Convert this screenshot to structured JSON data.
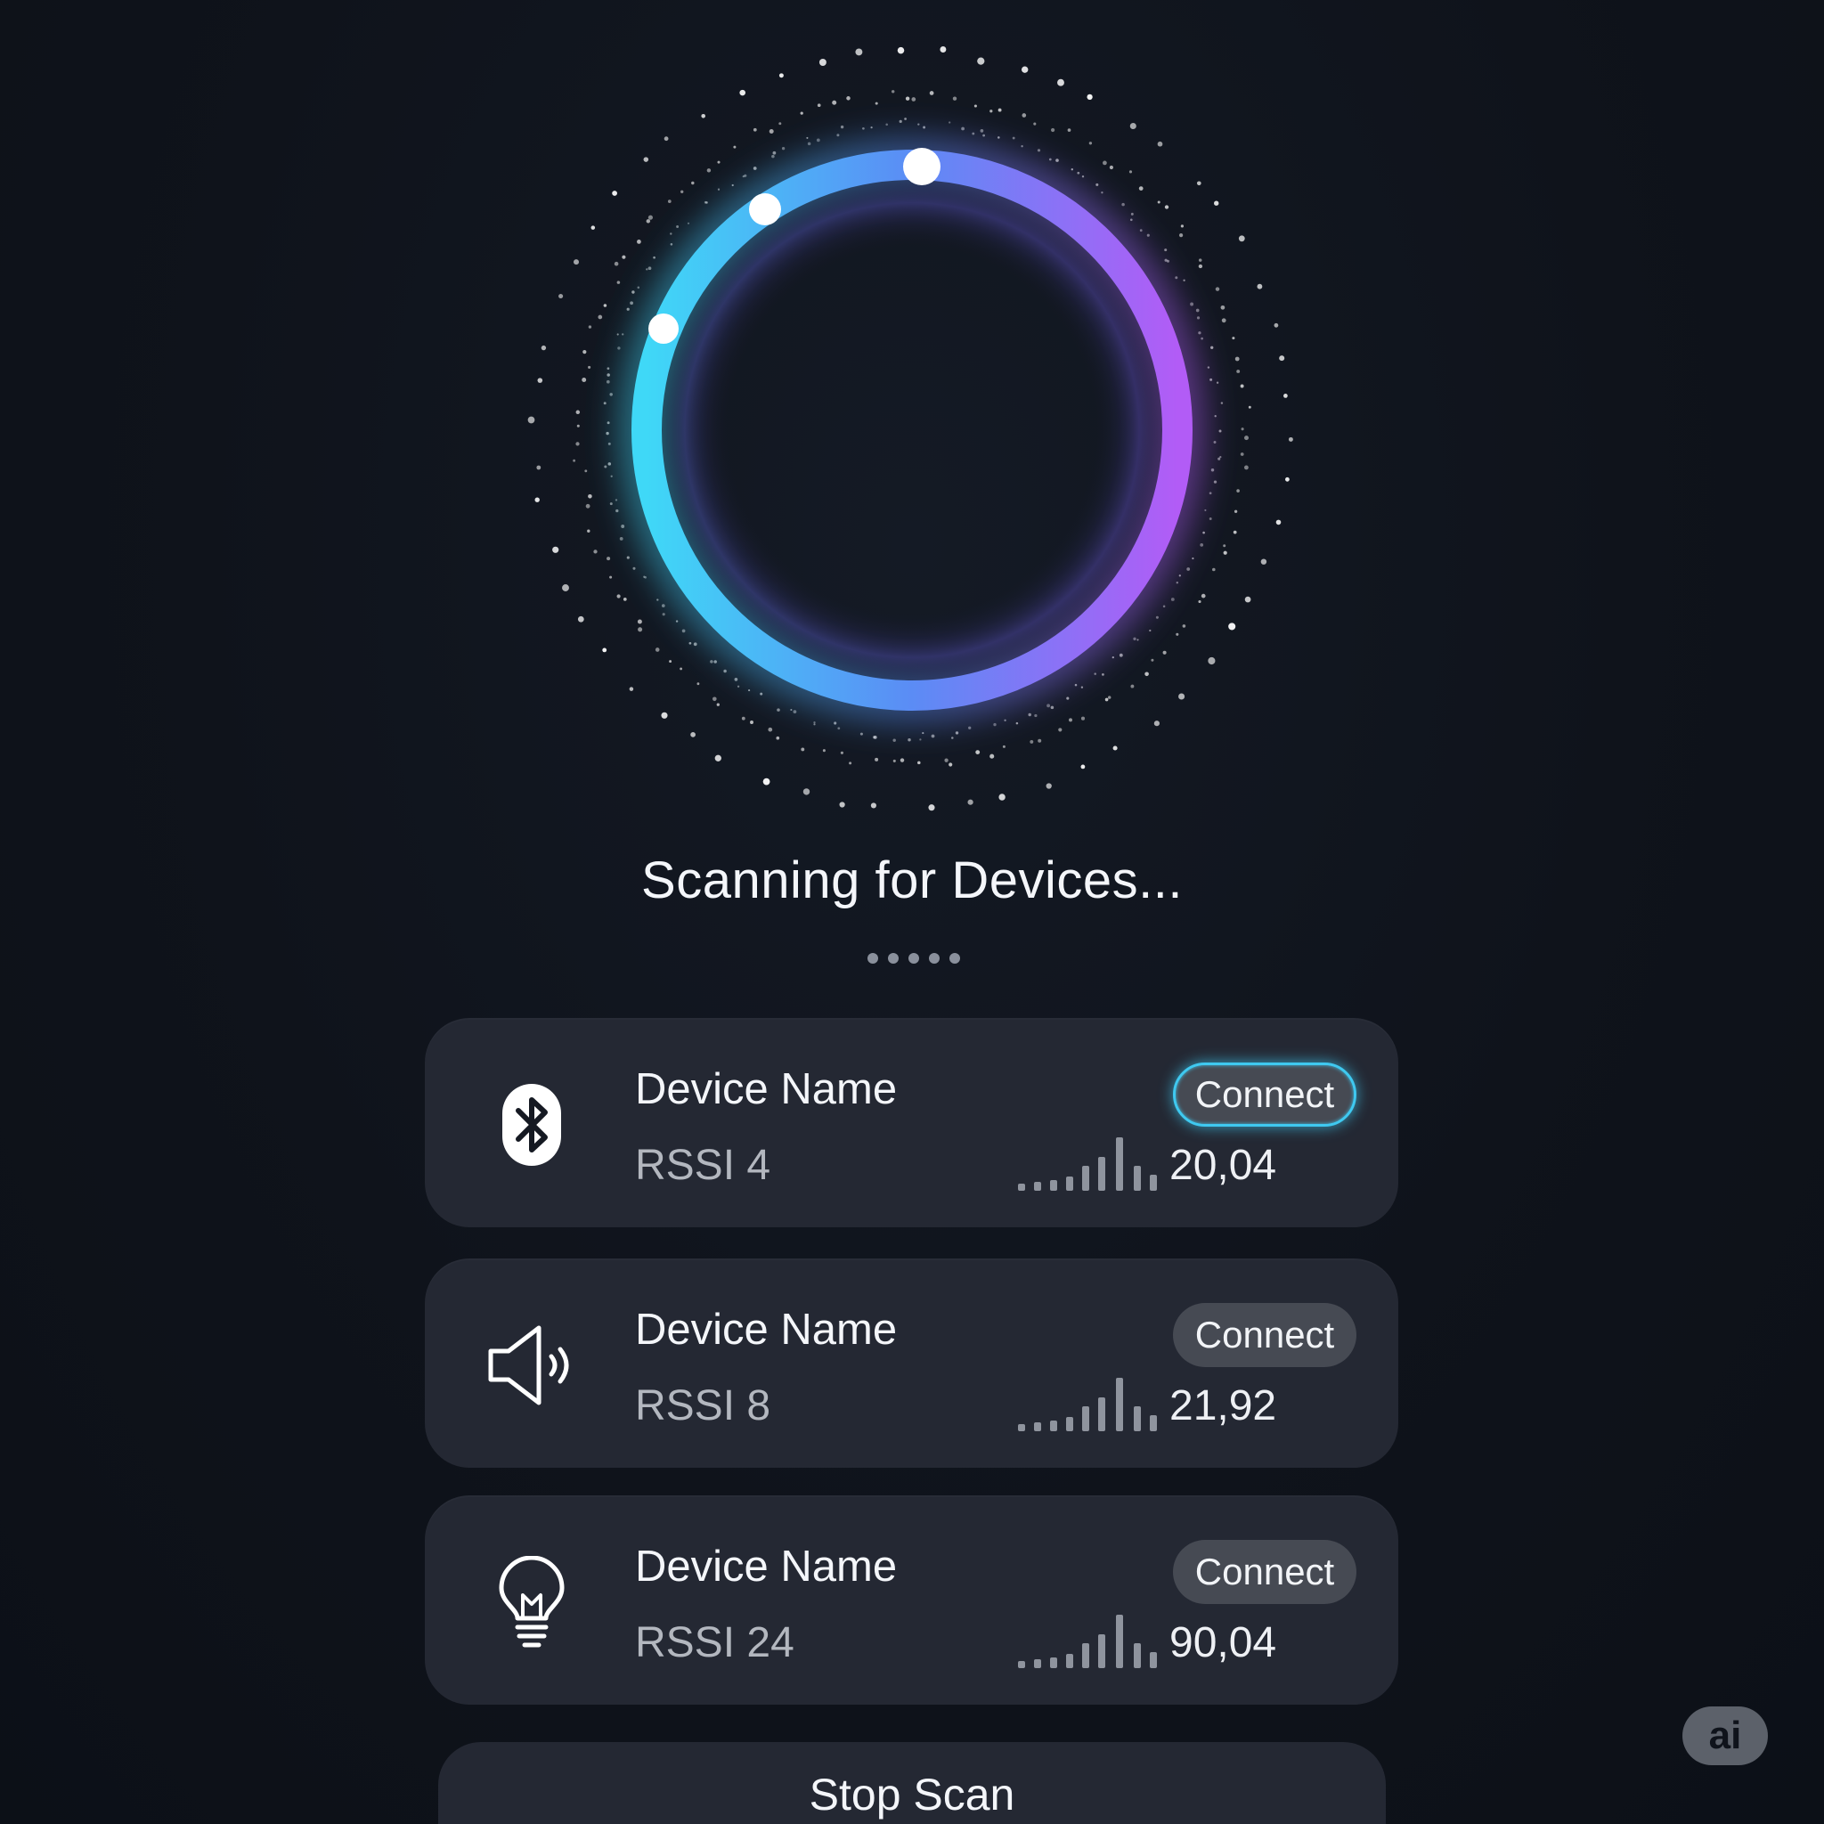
{
  "scanner": {
    "title": "Scanning for Devices...",
    "page_indicator_count": 5,
    "colors": {
      "ring_start": "#3fd8f7",
      "ring_mid": "#5b8cf5",
      "ring_end": "#b25cf6"
    }
  },
  "devices": [
    {
      "icon": "bluetooth-icon",
      "name": "Device Name",
      "rssi": "RSSI 4",
      "value": "20,04",
      "connect_label": "Connect",
      "highlighted": true
    },
    {
      "icon": "speaker-icon",
      "name": "Device Name",
      "rssi": "RSSI 8",
      "value": "21,92",
      "connect_label": "Connect",
      "highlighted": false
    },
    {
      "icon": "lightbulb-icon",
      "name": "Device Name",
      "rssi": "RSSI 24",
      "value": "90,04",
      "connect_label": "Connect",
      "highlighted": false
    }
  ],
  "footer": {
    "stop_label": "Stop Scan",
    "badge_label": "ai"
  }
}
